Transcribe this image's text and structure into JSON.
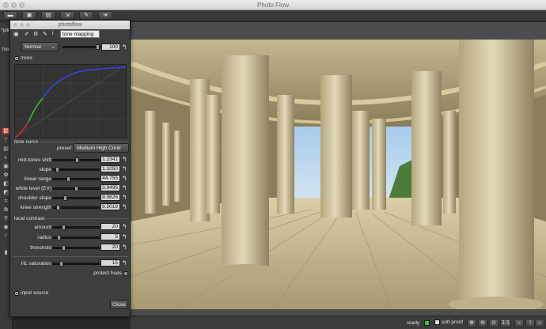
{
  "window": {
    "title": "Photo Flow"
  },
  "toolbar": {
    "icons": [
      "folder-icon",
      "save-icon",
      "save-as-icon",
      "export-icon",
      "edit-icon",
      "forward-icon"
    ]
  },
  "behind_labels": {
    "tab_fragment": "*pili",
    "hist_fragment": "hist"
  },
  "dialog": {
    "title": "photoflow",
    "module_name": "tone mapping",
    "blend_mode": "Normal",
    "opacity": "100",
    "more_label": "more",
    "tone_curve_label": "tone curve",
    "preset_label": "preset:",
    "preset_value": "Medium High Contr",
    "params": [
      {
        "label": "mid-tones shift",
        "value": "1.2341",
        "pos": 0.52
      },
      {
        "label": "slope",
        "value": "1.1050",
        "pos": 0.05
      },
      {
        "label": "linear range",
        "value": "44.755",
        "pos": 0.32
      },
      {
        "label": "white level (EV)",
        "value": "3.9495",
        "pos": 0.5
      },
      {
        "label": "shoulder slope",
        "value": "9.3626",
        "pos": 0.25
      },
      {
        "label": "knee strength",
        "value": "9.5019",
        "pos": 0.08
      }
    ],
    "local_contrast_label": "local contrast",
    "lc_params": [
      {
        "label": "amount",
        "value": "20",
        "pos": 0.2
      },
      {
        "label": "radius",
        "value": "5",
        "pos": 0.1
      },
      {
        "label": "threshold",
        "value": "20",
        "pos": 0.2
      }
    ],
    "hl_saturation_label": "HL saturation",
    "hl_saturation_value": "15",
    "hl_saturation_pos": 0.15,
    "protect_hues_label": "protect hues",
    "input_source_label": "input source",
    "close_label": "Close"
  },
  "status": {
    "ready_label": "ready",
    "soft_proof_label": "soft proof",
    "zoom_one": "1:1",
    "ready_color": "#22cc22"
  }
}
